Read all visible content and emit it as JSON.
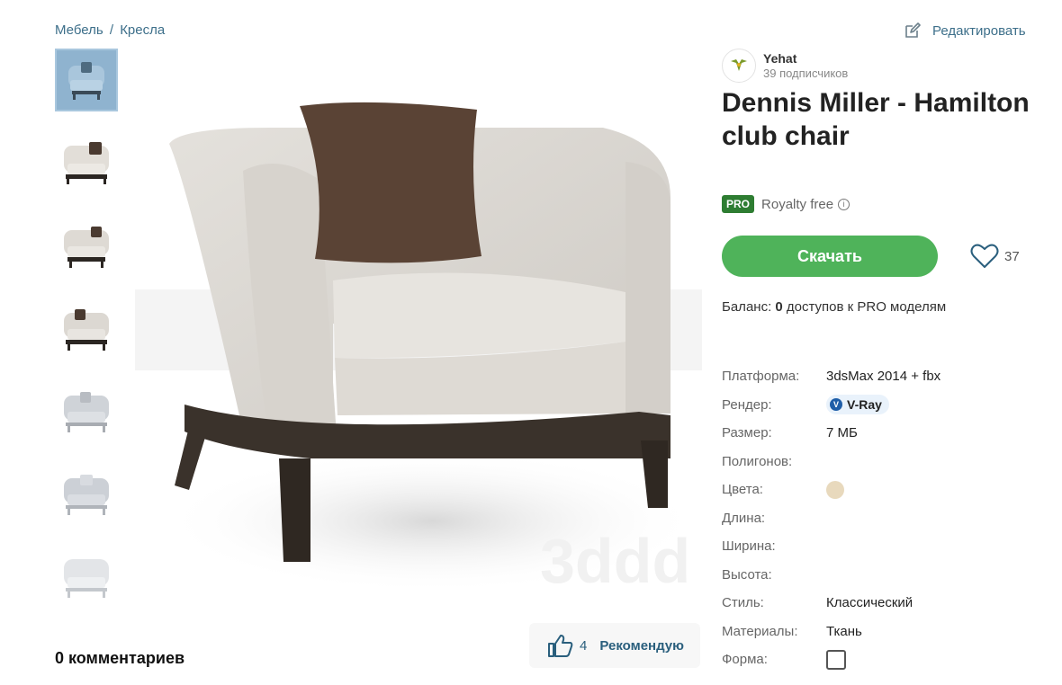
{
  "breadcrumb": {
    "parent": "Мебель",
    "separator": "/",
    "current": "Кресла"
  },
  "edit": {
    "label": "Редактировать",
    "icon": "edit-icon"
  },
  "author": {
    "name": "Yehat",
    "subscribers": "39 подписчиков"
  },
  "product": {
    "title": "Dennis Miller - Hamilton club chair"
  },
  "license": {
    "badge": "PRO",
    "label": "Royalty free",
    "info_glyph": "i"
  },
  "download": {
    "label": "Скачать"
  },
  "likes": {
    "count": "37"
  },
  "balance": {
    "prefix": "Баланс:",
    "count": "0",
    "suffix": "доступов к PRO моделям"
  },
  "specs": {
    "platform": {
      "label": "Платформа:",
      "value": "3dsMax 2014 + fbx"
    },
    "render": {
      "label": "Рендер:",
      "value": "V-Ray",
      "badge_glyph": "V"
    },
    "size": {
      "label": "Размер:",
      "value": "7 МБ"
    },
    "polygons": {
      "label": "Полигонов:",
      "value": ""
    },
    "colors": {
      "label": "Цвета:",
      "swatch": "#e8d9bd"
    },
    "length": {
      "label": "Длина:",
      "value": ""
    },
    "width": {
      "label": "Ширина:",
      "value": ""
    },
    "height": {
      "label": "Высота:",
      "value": ""
    },
    "style": {
      "label": "Стиль:",
      "value": "Классический"
    },
    "materials": {
      "label": "Материалы:",
      "value": "Ткань"
    },
    "form": {
      "label": "Форма:",
      "checked": false
    }
  },
  "recommend": {
    "count": "4",
    "label": "Рекомендую"
  },
  "comments": {
    "label": "0 комментариев"
  },
  "watermark": "3ddd",
  "thumbnails": {
    "count": 7,
    "active_index": 0
  },
  "colors": {
    "accent_green": "#4fb35a",
    "pro_green": "#2e7d32",
    "link_blue": "#3d6f8a"
  }
}
